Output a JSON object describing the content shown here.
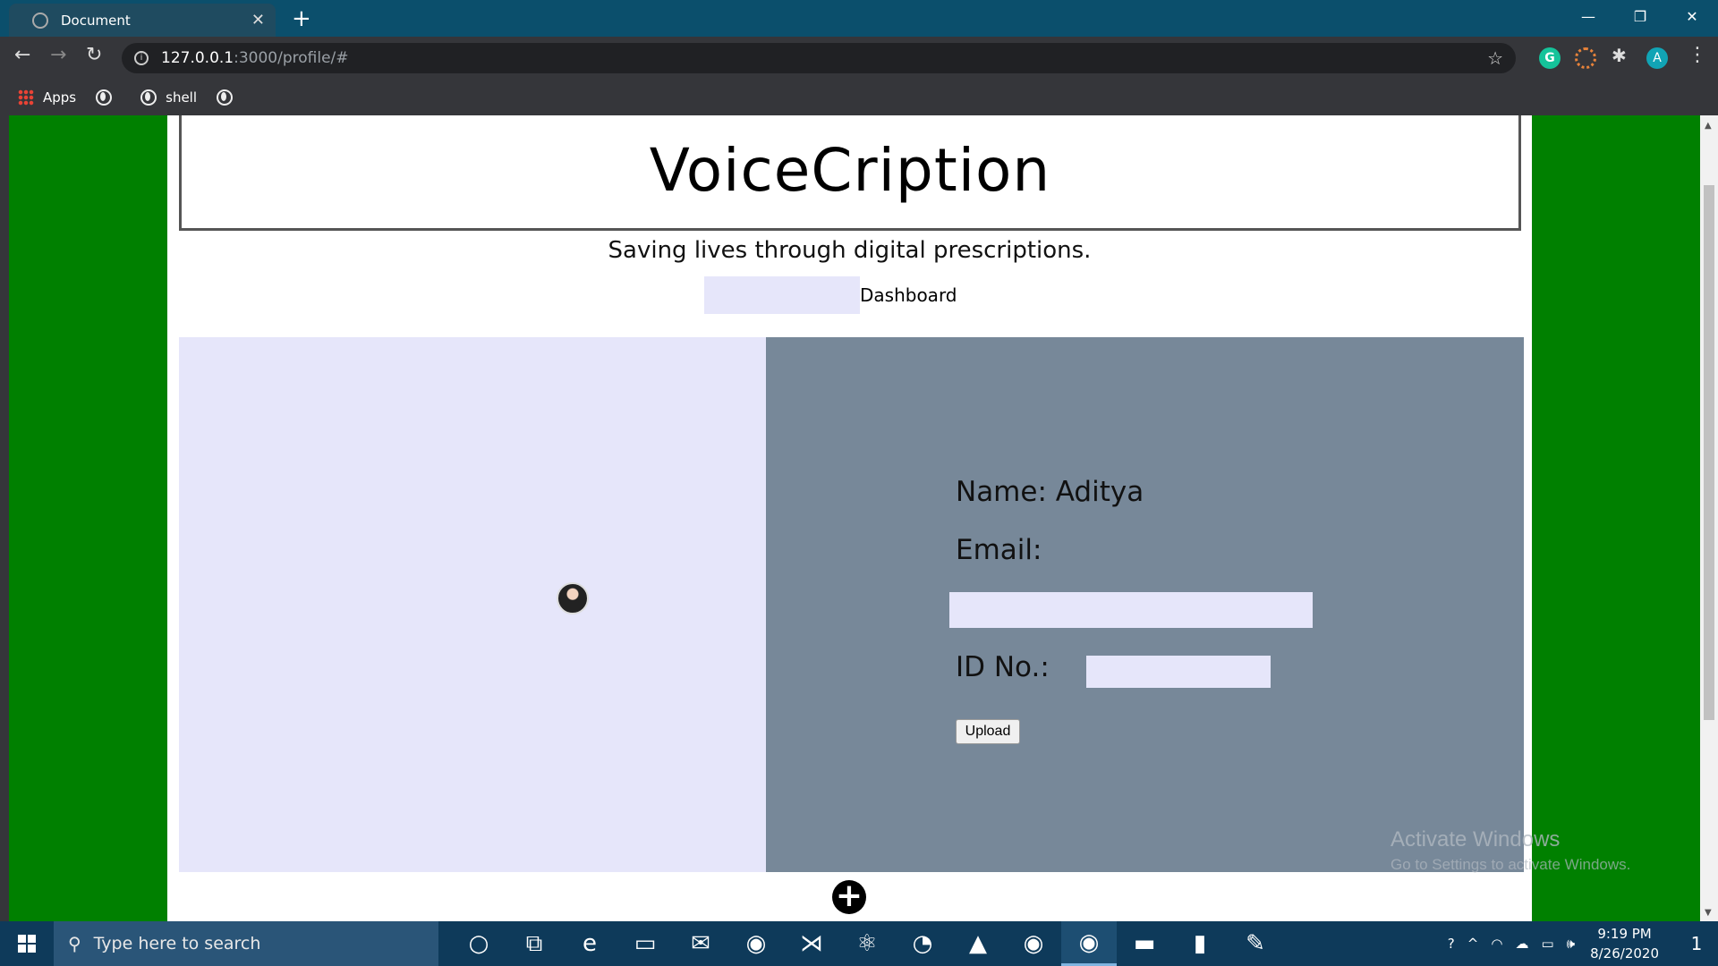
{
  "browser": {
    "tab_title": "Document",
    "tab_close": "✕",
    "new_tab": "+",
    "window_controls": {
      "minimize": "—",
      "restore": "❐",
      "close": "✕"
    },
    "nav": {
      "back": "←",
      "forward": "→",
      "reload": "↻"
    },
    "url_host": "127.0.0.1",
    "url_path": ":3000/profile/#",
    "info_icon": "i",
    "star": "☆",
    "extensions": {
      "grammarly": "G",
      "puzzle": "✱",
      "profile": "A",
      "menu": "⋮"
    },
    "bookmarks": [
      {
        "label": "Apps"
      },
      {
        "label": ""
      },
      {
        "label": "shell"
      },
      {
        "label": ""
      }
    ]
  },
  "page": {
    "brand": "VoiceCription",
    "tagline": "Saving lives through digital prescriptions.",
    "nav_dashboard": "Dashboard",
    "profile": {
      "name_line": "Name: Aditya",
      "email_label": "Email:",
      "id_label": "ID No.:",
      "upload_button": "Upload"
    },
    "plus_button": "+",
    "watermark": {
      "line1": "Activate Windows",
      "line2": "Go to Settings to activate Windows."
    }
  },
  "taskbar": {
    "search_placeholder": "Type here to search",
    "search_icon": "⚲",
    "pinned": [
      {
        "name": "cortana-icon",
        "glyph": "○"
      },
      {
        "name": "task-view-icon",
        "glyph": "⧉"
      },
      {
        "name": "edge-icon",
        "glyph": "e"
      },
      {
        "name": "file-explorer-icon",
        "glyph": "▭"
      },
      {
        "name": "mail-icon",
        "glyph": "✉"
      },
      {
        "name": "chrome-icon",
        "glyph": "◉"
      },
      {
        "name": "vscode-icon",
        "glyph": "⋊"
      },
      {
        "name": "atom-icon",
        "glyph": "⚛"
      },
      {
        "name": "firefox-icon",
        "glyph": "◔"
      },
      {
        "name": "vlc-icon",
        "glyph": "▲"
      },
      {
        "name": "chrome-profile-icon",
        "glyph": "◉"
      },
      {
        "name": "chrome-active-icon",
        "glyph": "◉"
      },
      {
        "name": "terminal-icon",
        "glyph": "▬"
      },
      {
        "name": "sticky-notes-icon",
        "glyph": "▮"
      },
      {
        "name": "paint-icon",
        "glyph": "✎"
      }
    ],
    "tray": {
      "help": "?",
      "chevron": "^",
      "wifi": "◠",
      "cloud": "☁",
      "battery": "▭",
      "volume": "🕪"
    },
    "time": "9:19 PM",
    "date": "8/26/2020",
    "notifications": "1"
  },
  "colors": {
    "side_green": "#008000",
    "lavender": "#e6e6fa",
    "slate_gray": "#778899"
  }
}
